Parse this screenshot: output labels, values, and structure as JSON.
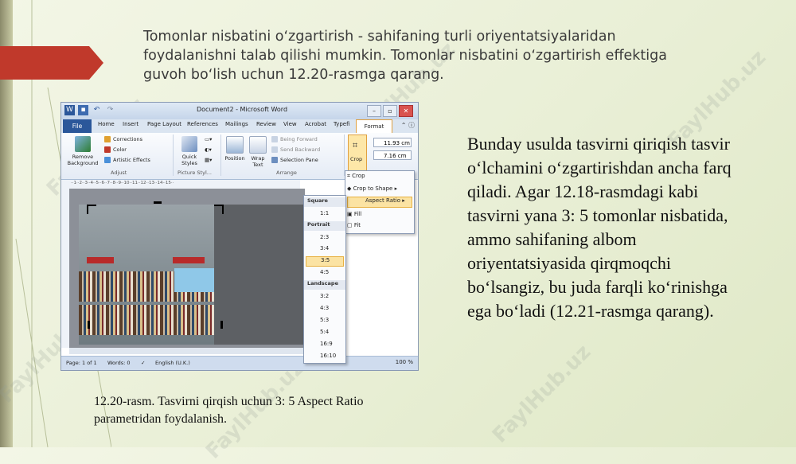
{
  "slide": {
    "heading": "Tomonlar nisbatini oʻzgartirish  - sahifaning turli  oriyentatsiyalaridan foydalanishni talab qilishi mumkin. Tomonlar nisbatini oʻzgartirish effektiga guvoh boʻlish uchun 12.20-rasmga qarang.",
    "body": "Bunday usulda tasvirni qiriqish tasvir oʻlchamini oʻzgartirishdan ancha farq qiladi. Agar 12.18-rasmdagi kabi tasvirni yana 3: 5 tomonlar nisbatida, ammo sahifaning albom oriyentatsiyasida qirqmoqchi boʻlsangiz, bu juda farqli koʻrinishga ega boʻladi (12.21-rasmga qarang).",
    "caption": "12.20-rasm. Tasvirni qirqish uchun 3: 5 Aspect Ratio parametridan foydalanish.",
    "watermark": "FaylHub.uz"
  },
  "word": {
    "window_title": "Document2 - Microsoft Word",
    "tabs": [
      "File",
      "Home",
      "Insert",
      "Page Layout",
      "References",
      "Mailings",
      "Review",
      "View",
      "Acrobat",
      "Typefi",
      "Format"
    ],
    "ribbon": {
      "remove_background": "Remove Background",
      "corrections": "Corrections",
      "color": "Color",
      "artistic_effects": "Artistic Effects",
      "adjust_group": "Adjust",
      "quick_styles": "Quick Styles",
      "picture_styles_group": "Picture Styl...",
      "position": "Position",
      "wrap_text": "Wrap Text",
      "bring_forward": "Being Forward",
      "send_backward": "Send Backward",
      "selection_pane": "Selection Pane",
      "arrange_group": "Arrange",
      "crop": "Crop",
      "height": "11.93 cm",
      "width": "7.16 cm"
    },
    "crop_menu": [
      "Crop",
      "Crop to Shape",
      "Aspect Ratio",
      "Fill",
      "Fit"
    ],
    "aspect_menu": {
      "square_header": "Square",
      "square": [
        "1:1"
      ],
      "portrait_header": "Portrait",
      "portrait": [
        "2:3",
        "3:4",
        "3:5",
        "4:5"
      ],
      "landscape_header": "Landscape",
      "landscape": [
        "3:2",
        "4:3",
        "5:3",
        "5:4",
        "16:9",
        "16:10"
      ],
      "selected": "3:5"
    },
    "status": {
      "page": "Page: 1 of 1",
      "words": "Words: 0",
      "language": "English (U.K.)",
      "zoom": "100 %"
    }
  },
  "colors": {
    "accent_red": "#c0392b",
    "word_blue": "#2b579a",
    "highlight": "#fbe3a3"
  }
}
